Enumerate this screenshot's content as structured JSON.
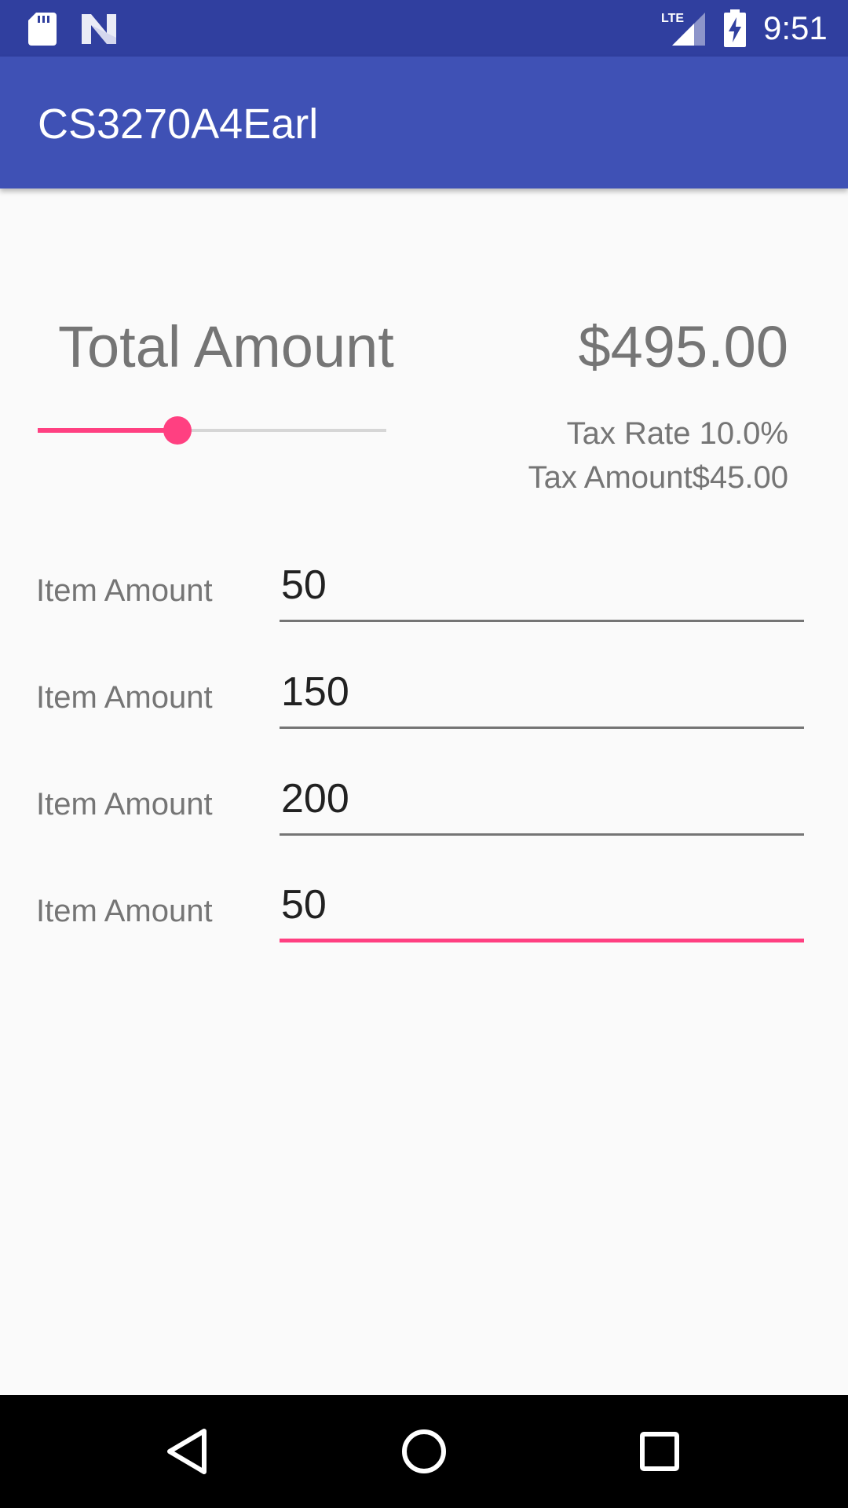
{
  "status_bar": {
    "time": "9:51",
    "network": "LTE",
    "icons": [
      "sd-card-icon",
      "n-notification-icon",
      "lte-signal-icon",
      "battery-charging-icon"
    ],
    "background_color": "#303f9f"
  },
  "app_bar": {
    "title": "CS3270A4Earl",
    "background_color": "#3f51b5"
  },
  "summary": {
    "total_label": "Total Amount",
    "total_value": "$495.00",
    "tax_rate": "Tax Rate 10.0%",
    "tax_amount": "Tax Amount$45.00"
  },
  "tax_slider": {
    "value_fraction": 0.4,
    "accent_color": "#ff4081"
  },
  "items": [
    {
      "label": "Item Amount",
      "value": "50"
    },
    {
      "label": "Item Amount",
      "value": "150"
    },
    {
      "label": "Item Amount",
      "value": "200"
    },
    {
      "label": "Item Amount",
      "value": "50"
    }
  ],
  "focused_item_index": 3,
  "nav_bar": {
    "icons": [
      "back-icon",
      "home-icon",
      "recents-icon"
    ]
  }
}
